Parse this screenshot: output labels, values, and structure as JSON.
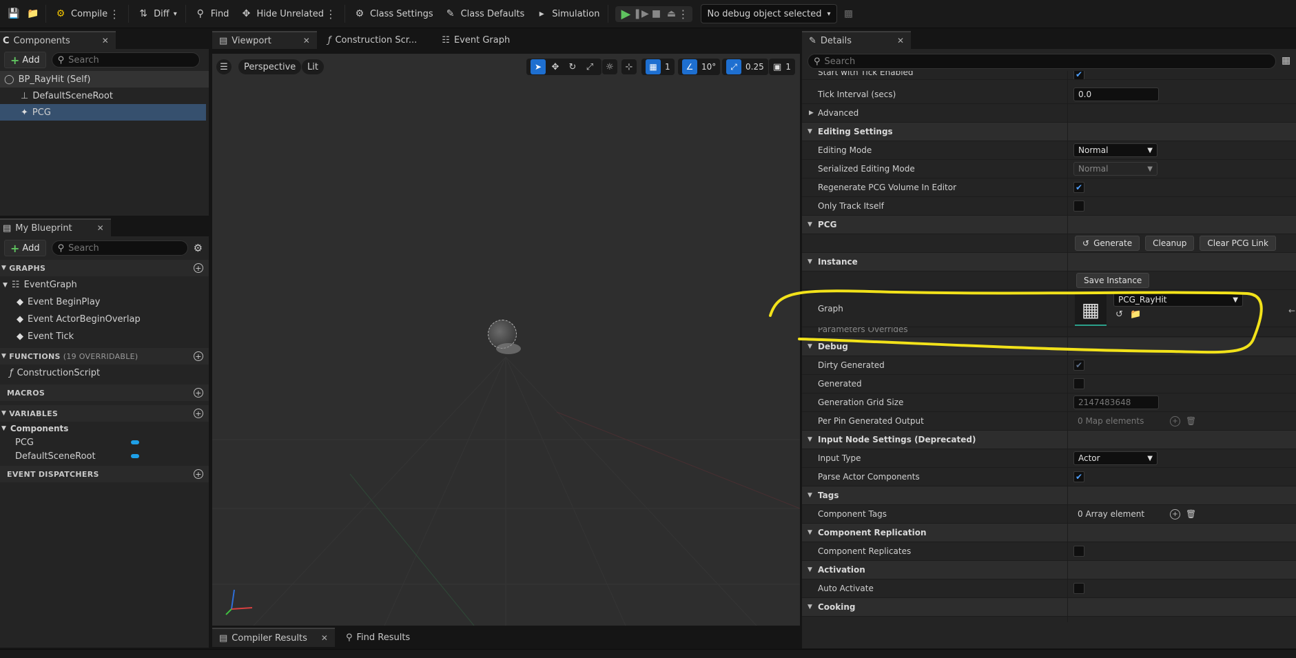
{
  "toolbar": {
    "compile": "Compile",
    "diff": "Diff",
    "find": "Find",
    "hide_unrelated": "Hide Unrelated",
    "class_settings": "Class Settings",
    "class_defaults": "Class Defaults",
    "simulation": "Simulation",
    "debug_object": "No debug object selected"
  },
  "components_panel": {
    "tab": "Components",
    "add": "Add",
    "search_placeholder": "Search",
    "items": [
      "BP_RayHit (Self)",
      "DefaultSceneRoot",
      "PCG"
    ]
  },
  "my_blueprint": {
    "tab": "My Blueprint",
    "add": "Add",
    "search_placeholder": "Search",
    "graphs_header": "GRAPHS",
    "graph_name": "EventGraph",
    "events": [
      "Event BeginPlay",
      "Event ActorBeginOverlap",
      "Event Tick"
    ],
    "functions_header": "FUNCTIONS",
    "functions_overridable": "(19 OVERRIDABLE)",
    "function_items": [
      "ConstructionScript"
    ],
    "macros_header": "MACROS",
    "variables_header": "VARIABLES",
    "variables_category": "Components",
    "variable_items": [
      "PCG",
      "DefaultSceneRoot"
    ],
    "dispatchers_header": "EVENT DISPATCHERS"
  },
  "editor_tabs": [
    "Viewport",
    "Construction Scr...",
    "Event Graph"
  ],
  "viewport": {
    "perspective": "Perspective",
    "lit": "Lit",
    "grid_snap": "1",
    "rot_snap": "10°",
    "scale_snap": "0.25",
    "camera_speed": "1"
  },
  "bottom_tabs": [
    "Compiler Results",
    "Find Results"
  ],
  "details": {
    "tab": "Details",
    "search_placeholder": "Search",
    "rows": {
      "start_tick": "Start with Tick Enabled",
      "tick_interval": "Tick Interval (secs)",
      "tick_interval_value": "0.0",
      "advanced": "Advanced",
      "editing_settings": "Editing Settings",
      "editing_mode": "Editing Mode",
      "editing_mode_value": "Normal",
      "serialized_editing_mode": "Serialized Editing Mode",
      "serialized_editing_mode_value": "Normal",
      "regenerate": "Regenerate PCG Volume In Editor",
      "only_track": "Only Track Itself",
      "pcg": "PCG",
      "generate": "Generate",
      "cleanup": "Cleanup",
      "clear_link": "Clear PCG Link",
      "instance": "Instance",
      "save_instance": "Save Instance",
      "graph": "Graph",
      "graph_value": "PCG_RayHit",
      "parameter_overrides": "Parameters Overrides",
      "debug": "Debug",
      "dirty_generated": "Dirty Generated",
      "generated": "Generated",
      "grid_size": "Generation Grid Size",
      "grid_size_value": "2147483648",
      "per_pin": "Per Pin Generated Output",
      "per_pin_value": "0 Map elements",
      "input_node": "Input Node Settings (Deprecated)",
      "input_type": "Input Type",
      "input_type_value": "Actor",
      "parse_actor": "Parse Actor Components",
      "tags": "Tags",
      "component_tags": "Component Tags",
      "component_tags_value": "0 Array element",
      "component_replication": "Component Replication",
      "component_replicates": "Component Replicates",
      "activation": "Activation",
      "auto_activate": "Auto Activate",
      "cooking": "Cooking"
    }
  },
  "colors": {
    "accent_blue": "#1e6fd0",
    "play_green": "#5fc35f",
    "annotation_yellow": "#f2e21a",
    "selected_row": "#36506e"
  }
}
